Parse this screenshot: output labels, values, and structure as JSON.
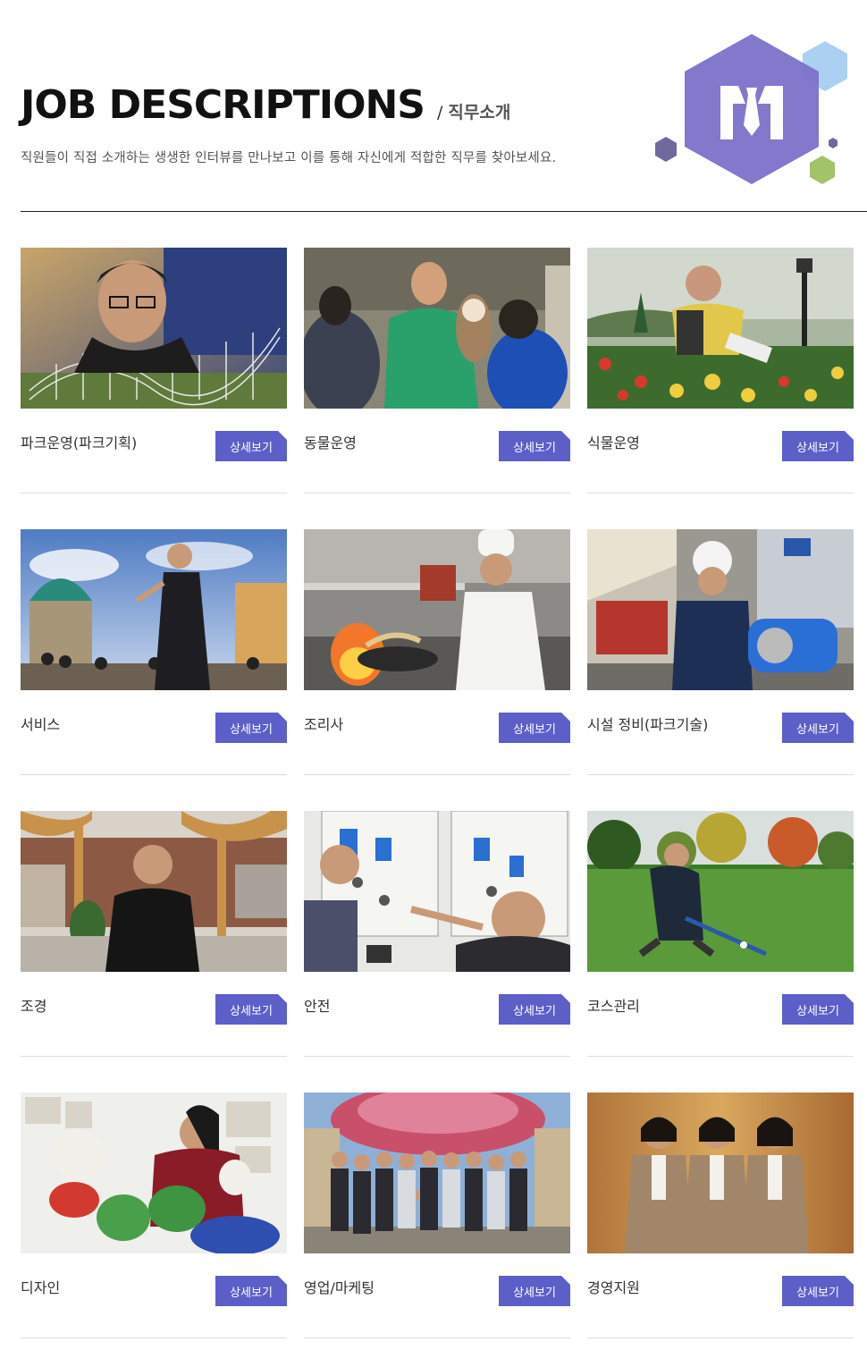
{
  "header": {
    "title": "JOB DESCRIPTIONS",
    "slash": "/",
    "subtitle": "직무소개",
    "description": "직원들이 직접 소개하는 생생한 인터뷰를 만나보고 이를 통해 자신에게 적합한 직무를 찾아보세요."
  },
  "colors": {
    "accent": "#5c5fc8",
    "hexagon_main": "#7b72c9",
    "hexagon_blue": "#9cc8ef",
    "hexagon_green": "#a3c36a",
    "hexagon_dark": "#6e6a9e"
  },
  "jobs": [
    {
      "name": "파크운영(파크기획)",
      "button": "상세보기",
      "scene": "roller-coaster-model"
    },
    {
      "name": "동물운영",
      "button": "상세보기",
      "scene": "owl-keeper"
    },
    {
      "name": "식물운영",
      "button": "상세보기",
      "scene": "rose-garden"
    },
    {
      "name": "서비스",
      "button": "상세보기",
      "scene": "park-guide"
    },
    {
      "name": "조리사",
      "button": "상세보기",
      "scene": "kitchen-chef"
    },
    {
      "name": "시설 정비(파크기술)",
      "button": "상세보기",
      "scene": "ride-maintenance"
    },
    {
      "name": "조경",
      "button": "상세보기",
      "scene": "landscape-building"
    },
    {
      "name": "안전",
      "button": "상세보기",
      "scene": "control-panel"
    },
    {
      "name": "코스관리",
      "button": "상세보기",
      "scene": "golf-green"
    },
    {
      "name": "디자인",
      "button": "상세보기",
      "scene": "plush-designer"
    },
    {
      "name": "영업/마케팅",
      "button": "상세보기",
      "scene": "group-photo"
    },
    {
      "name": "경영지원",
      "button": "상세보기",
      "scene": "office-staff"
    }
  ]
}
